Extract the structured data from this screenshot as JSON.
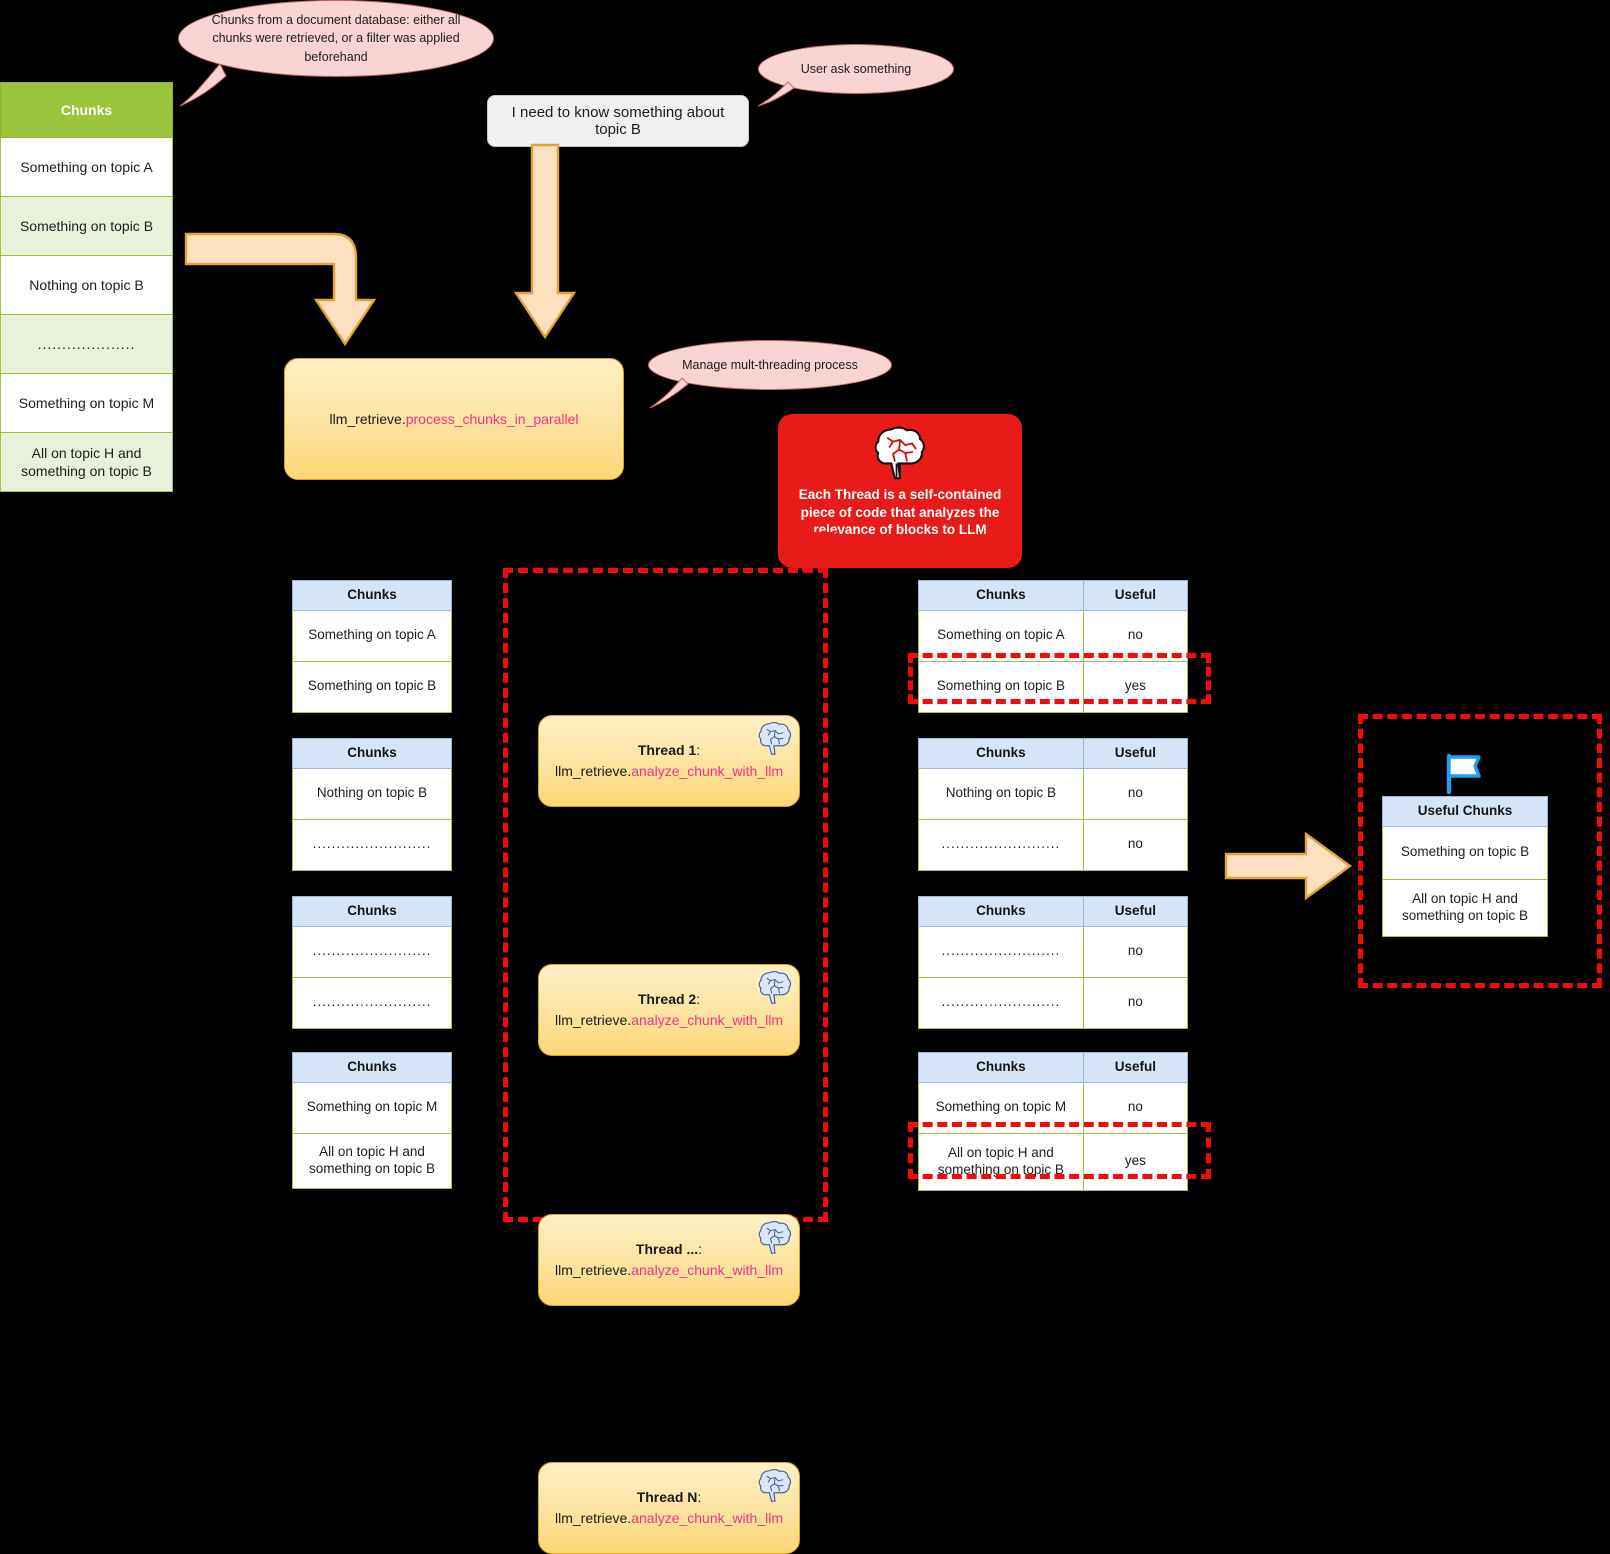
{
  "colors": {
    "green_header": "#9ac43c",
    "blue_header": "#d6e4f7",
    "accent_pink": "#f0328c",
    "callout_red": "#e81b18",
    "dashed_red": "#f50a0a",
    "arrow_orange": "#fde0c0",
    "bubble_pink": "#f8d4d2"
  },
  "source_table": {
    "header": "Chunks",
    "rows": [
      "Something on topic A",
      "Something on topic B",
      "Nothing on topic B",
      "....................",
      "Something on topic M",
      "All on topic H and something on topic B"
    ]
  },
  "bubbles": {
    "chunks_source": "Chunks from a document database: either all chunks were retrieved, or a filter was applied beforehand",
    "user_ask": "User ask something",
    "manage_threads": "Manage mult-threading process"
  },
  "user_message": "I need to know something about topic B",
  "process_box": {
    "prefix": "llm_retrieve.",
    "method": "process_chunks_in_parallel"
  },
  "thread_callout": {
    "icon": "brain-icon",
    "text": "Each Thread is a self-contained piece of code that analyzes the relevance of blocks to LLM"
  },
  "threads": [
    {
      "label": "Thread 1",
      "colon": ":",
      "prefix": "llm_retrieve.",
      "method": "analyze_chunk_with_llm",
      "icon": "brain-icon"
    },
    {
      "label": "Thread 2",
      "colon": ":",
      "prefix": "llm_retrieve.",
      "method": "analyze_chunk_with_llm",
      "icon": "brain-icon"
    },
    {
      "label": "Thread ...",
      "colon": ":",
      "prefix": "llm_retrieve.",
      "method": "analyze_chunk_with_llm",
      "icon": "brain-icon"
    },
    {
      "label": "Thread N",
      "colon": ":",
      "prefix": "llm_retrieve.",
      "method": "analyze_chunk_with_llm",
      "icon": "brain-icon"
    }
  ],
  "input_tables": [
    {
      "header": "Chunks",
      "rows": [
        "Something on topic A",
        "Something on topic B"
      ]
    },
    {
      "header": "Chunks",
      "rows": [
        "Nothing on topic B",
        "........................."
      ]
    },
    {
      "header": "Chunks",
      "rows": [
        ".........................",
        "........................."
      ]
    },
    {
      "header": "Chunks",
      "rows": [
        "Something on topic M",
        "All on topic H and something on topic B"
      ]
    }
  ],
  "output_tables": [
    {
      "headers": [
        "Chunks",
        "Useful"
      ],
      "rows": [
        {
          "chunk": "Something on topic A",
          "useful": "no"
        },
        {
          "chunk": "Something on topic B",
          "useful": "yes"
        }
      ]
    },
    {
      "headers": [
        "Chunks",
        "Useful"
      ],
      "rows": [
        {
          "chunk": "Nothing on topic B",
          "useful": "no"
        },
        {
          "chunk": ".........................",
          "useful": "no"
        }
      ]
    },
    {
      "headers": [
        "Chunks",
        "Useful"
      ],
      "rows": [
        {
          "chunk": ".........................",
          "useful": "no"
        },
        {
          "chunk": ".........................",
          "useful": "no"
        }
      ]
    },
    {
      "headers": [
        "Chunks",
        "Useful"
      ],
      "rows": [
        {
          "chunk": "Something on topic M",
          "useful": "no"
        },
        {
          "chunk": "All on topic H and something on topic B",
          "useful": "yes"
        }
      ]
    }
  ],
  "result_table": {
    "icon": "flag-icon",
    "header": "Useful Chunks",
    "rows": [
      "Something on topic B",
      "All on topic H and something on topic B"
    ]
  }
}
